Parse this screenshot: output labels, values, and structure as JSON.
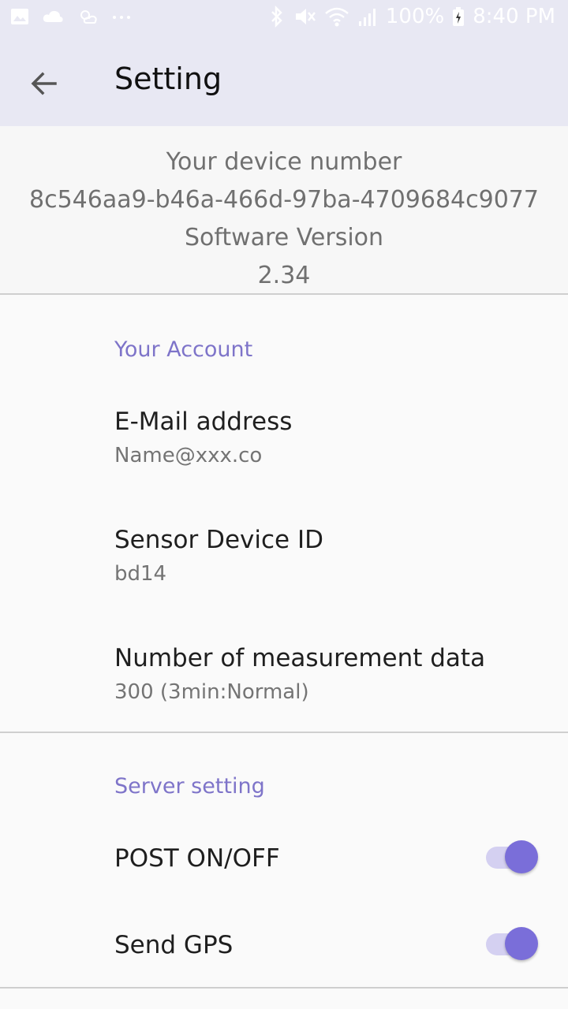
{
  "status_bar": {
    "battery": "100%",
    "time": "8:40 PM",
    "icons": [
      "image-icon",
      "cloud-icon",
      "weather-icon",
      "more-dots-icon",
      "bluetooth-icon",
      "mute-icon",
      "wifi-icon",
      "signal-icon",
      "battery-charging-icon"
    ]
  },
  "app_bar": {
    "title": "Setting",
    "back_icon": "arrow-back-icon"
  },
  "device": {
    "number_label": "Your device number",
    "number_value": "8c546aa9-b46a-466d-97ba-4709684c9077",
    "software_label": "Software Version",
    "software_value": "2.34"
  },
  "account": {
    "header": "Your Account",
    "email_title": "E-Mail address",
    "email_value": "Name@xxx.co",
    "sensor_title": "Sensor Device ID",
    "sensor_value": "bd14",
    "measurement_title": "Number of measurement data",
    "measurement_value": "300 (3min:Normal)"
  },
  "server": {
    "header": "Server setting",
    "post_label": "POST ON/OFF",
    "post_on": true,
    "gps_label": "Send GPS",
    "gps_on": true
  },
  "colors": {
    "accent": "#7a6ed9",
    "app_bar": "#e8e8f3"
  }
}
